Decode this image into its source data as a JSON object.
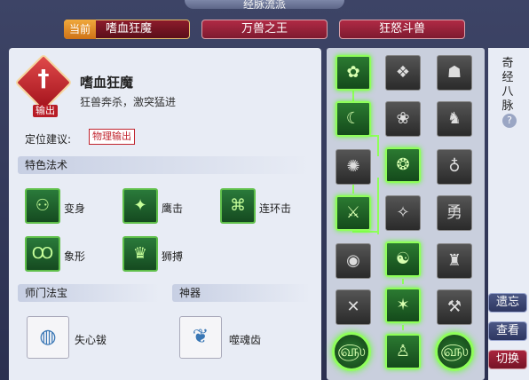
{
  "window": {
    "title": "经脉流派"
  },
  "tabs": [
    {
      "label": "嗜血狂魔",
      "tag": "当前",
      "active": true
    },
    {
      "label": "万兽之王"
    },
    {
      "label": "狂怒斗兽"
    }
  ],
  "school": {
    "badge_label": "输出",
    "name": "嗜血狂魔",
    "description": "狂兽奔杀，激突猛进",
    "role_label": "定位建议:",
    "role_tag": "物理输出"
  },
  "sections": {
    "special_skills": "特色法术",
    "treasure": "师门法宝",
    "artifact": "神器"
  },
  "skills": [
    {
      "name": "变身",
      "icon": "transform-icon"
    },
    {
      "name": "鹰击",
      "icon": "eagle-strike-icon"
    },
    {
      "name": "连环击",
      "icon": "chain-strike-icon"
    },
    {
      "name": "象形",
      "icon": "elephant-form-icon"
    },
    {
      "name": "狮搏",
      "icon": "lion-strike-icon"
    }
  ],
  "treasure_item": {
    "name": "失心钹",
    "icon": "cymbal-icon"
  },
  "artifact_item": {
    "name": "噬魂齿",
    "icon": "soul-tooth-icon"
  },
  "side": {
    "title": "奇经八脉",
    "help": "?",
    "buttons": [
      "遗忘",
      "查看",
      "切换"
    ]
  },
  "colors": {
    "accent_green": "#8fff5a",
    "tab_red": "#b02a45",
    "tag_orange": "#e69030"
  }
}
